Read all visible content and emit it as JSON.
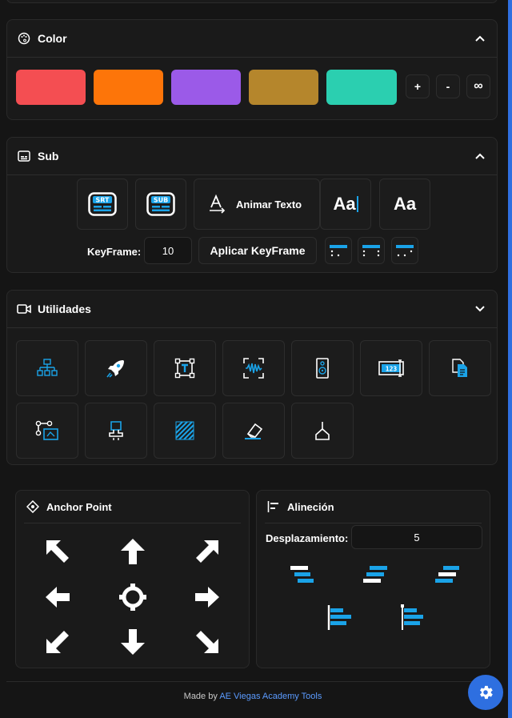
{
  "color": {
    "title": "Color",
    "swatches": [
      "#f44e52",
      "#fd7509",
      "#9b5ae8",
      "#b5862c",
      "#2bcfb0"
    ],
    "plus_label": "+",
    "minus_label": "-",
    "infinity_label": "∞"
  },
  "sub": {
    "title": "Sub",
    "srt_label": "SRT",
    "sub_label": "SUB",
    "animate_label": "Animar Texto",
    "aa1_label": "Aa",
    "aa2_label": "Aa",
    "keyframe_label": "KeyFrame:",
    "keyframe_value": "10",
    "apply_label": "Aplicar KeyFrame",
    "num_icon_label": "123"
  },
  "utilidades": {
    "title": "Utilidades"
  },
  "anchor": {
    "title": "Anchor Point"
  },
  "align": {
    "title": "Alineción",
    "offset_label": "Desplazamiento:",
    "offset_value": "5"
  },
  "footer": {
    "prefix": "Made by",
    "link": "AE Viegas Academy Tools"
  },
  "colors": {
    "accent": "#1aa3e8",
    "fab": "#2e6fe0"
  }
}
